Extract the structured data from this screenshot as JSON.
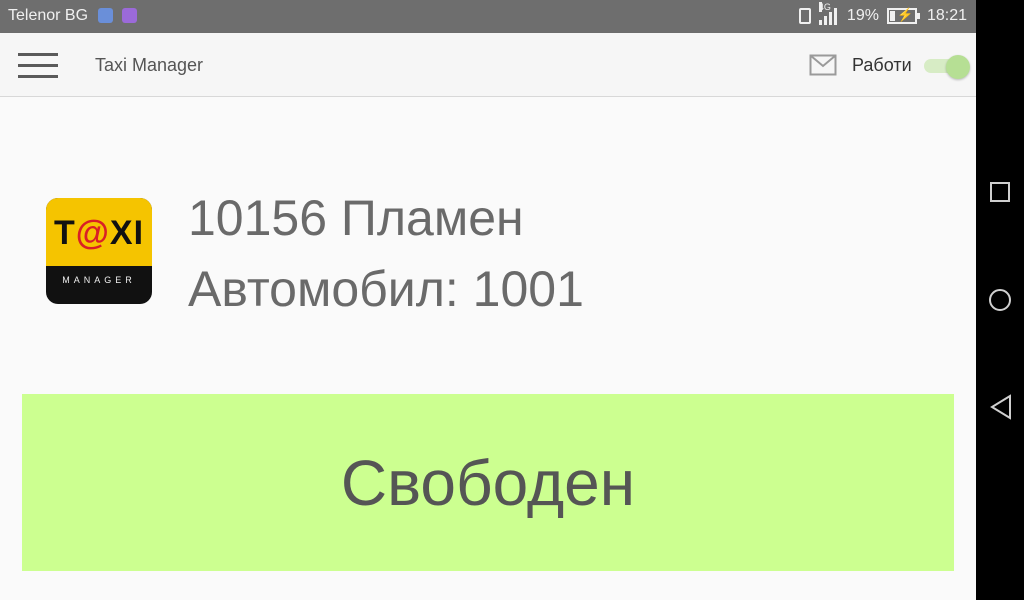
{
  "status_bar": {
    "carrier": "Telenor BG",
    "network": "4G",
    "battery_percent": 19,
    "battery_label": "19%",
    "time": "18:21"
  },
  "app_bar": {
    "title": "Taxi Manager",
    "work_label": "Работи",
    "work_toggle_on": true
  },
  "logo": {
    "word_t": "T",
    "word_at": "@",
    "word_xi": "XI",
    "subtitle": "MANAGER"
  },
  "driver": {
    "id_name": "10156 Пламен",
    "car": "Автомобил: 1001"
  },
  "status_button": {
    "label": "Свободен"
  },
  "colors": {
    "status_free": "#ccff90",
    "logo_yellow": "#f5c400",
    "toggle_on": "#b6df94"
  }
}
